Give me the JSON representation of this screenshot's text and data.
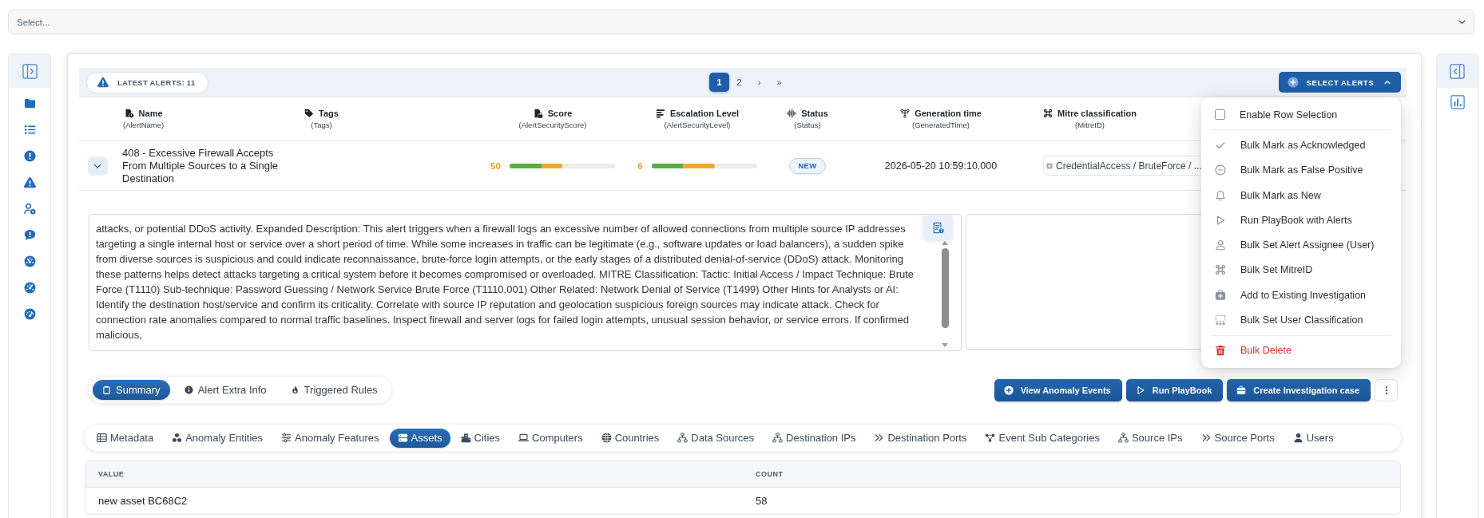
{
  "select_field": {
    "placeholder": "Select..."
  },
  "alerts_toolbar": {
    "badge": "LATEST ALERTS: 11",
    "pages": [
      {
        "label": "1",
        "selected": true
      },
      {
        "label": "2",
        "selected": false
      }
    ],
    "next": "›",
    "last": "»",
    "select_alerts": {
      "label": "SELECT ALERTS",
      "expanded": true,
      "menu": [
        {
          "kind": "checkbox",
          "label": "Enable Row Selection",
          "checked": false
        },
        {
          "kind": "action",
          "label": "Bulk Mark as Acknowledged"
        },
        {
          "kind": "action",
          "label": "Bulk Mark as False Positive"
        },
        {
          "kind": "action",
          "label": "Bulk Mark as New"
        },
        {
          "kind": "action",
          "label": "Run PlayBook with Alerts"
        },
        {
          "kind": "action",
          "label": "Bulk Set Alert Assignee (User)"
        },
        {
          "kind": "action",
          "label": "Bulk Set MitreID"
        },
        {
          "kind": "action",
          "label": "Add to Existing Investigation"
        },
        {
          "kind": "action",
          "label": "Bulk Set User Classification"
        },
        {
          "kind": "danger",
          "label": "Bulk Delete"
        }
      ]
    }
  },
  "columns": [
    {
      "title": "Name",
      "field": "(AlertName)"
    },
    {
      "title": "Tags",
      "field": "(Tags)"
    },
    {
      "title": "Score",
      "field": "(AlertSecurityScore)"
    },
    {
      "title": "Escalation Level",
      "field": "(AlertSecurityLevel)"
    },
    {
      "title": "Status",
      "field": "(Status)"
    },
    {
      "title": "Generation time",
      "field": "(GeneratedTime)"
    },
    {
      "title": "Mitre classification",
      "field": "(MitreID)"
    }
  ],
  "alerts": [
    {
      "name": "408 - Excessive Firewall Accepts From Multiple Sources to a Single Destination",
      "expanded": true,
      "score": {
        "value": "50",
        "level": 0.5
      },
      "escalation": {
        "value": "6",
        "level": 0.6
      },
      "status": "NEW",
      "generated": "2026-05-20 10:59:10.000",
      "mitre": "CredentialAccess / BruteForce / ...",
      "details": {
        "description": "attacks, or potential DDoS activity. Expanded Description: This alert triggers when a firewall logs an excessive number of allowed connections from multiple source IP addresses targeting a single internal host or service over a short period of time. While some increases in traffic can be legitimate (e.g., software updates or load balancers), a sudden spike from diverse sources is suspicious and could indicate reconnaissance, brute-force login attempts, or the early stages of a distributed denial-of-service (DDoS) attack. Monitoring these patterns helps detect attacks targeting a critical system before it becomes compromised or overloaded. MITRE Classification: Tactic: Initial Access / Impact Technique: Brute Force (T1110) Sub-technique: Password Guessing / Network Service Brute Force (T1110.001) Other Related: Network Denial of Service (T1499) Other Hints for Analysts or AI: Identify the destination host/service and confirm its criticality. Correlate with source IP reputation and geolocation suspicious foreign sources may indicate attack. Check for connection rate anomalies compared to normal traffic baselines. Inspect firewall and server logs for failed login attempts, unusual session behavior, or service errors. If confirmed malicious,",
        "info_tabs": [
          {
            "label": "Summary",
            "selected": true
          },
          {
            "label": "Alert Extra Info",
            "selected": false
          },
          {
            "label": "Triggered Rules",
            "selected": false
          }
        ],
        "actions": [
          {
            "label": "View Anomaly Events"
          },
          {
            "label": "Run PlayBook"
          },
          {
            "label": "Create Investigation case"
          }
        ],
        "data_tabs": [
          {
            "label": "Metadata",
            "selected": false
          },
          {
            "label": "Anomaly Entities",
            "selected": false
          },
          {
            "label": "Anomaly Features",
            "selected": false
          },
          {
            "label": "Assets",
            "selected": true
          },
          {
            "label": "Cities",
            "selected": false
          },
          {
            "label": "Computers",
            "selected": false
          },
          {
            "label": "Countries",
            "selected": false
          },
          {
            "label": "Data Sources",
            "selected": false
          },
          {
            "label": "Destination IPs",
            "selected": false
          },
          {
            "label": "Destination Ports",
            "selected": false
          },
          {
            "label": "Event Sub Categories",
            "selected": false
          },
          {
            "label": "Source IPs",
            "selected": false
          },
          {
            "label": "Source Ports",
            "selected": false
          },
          {
            "label": "Users",
            "selected": false
          }
        ],
        "table": {
          "columns": [
            "VALUE",
            "COUNT"
          ],
          "rows": [
            [
              "new asset BC68C2",
              "58"
            ]
          ]
        }
      }
    }
  ]
}
